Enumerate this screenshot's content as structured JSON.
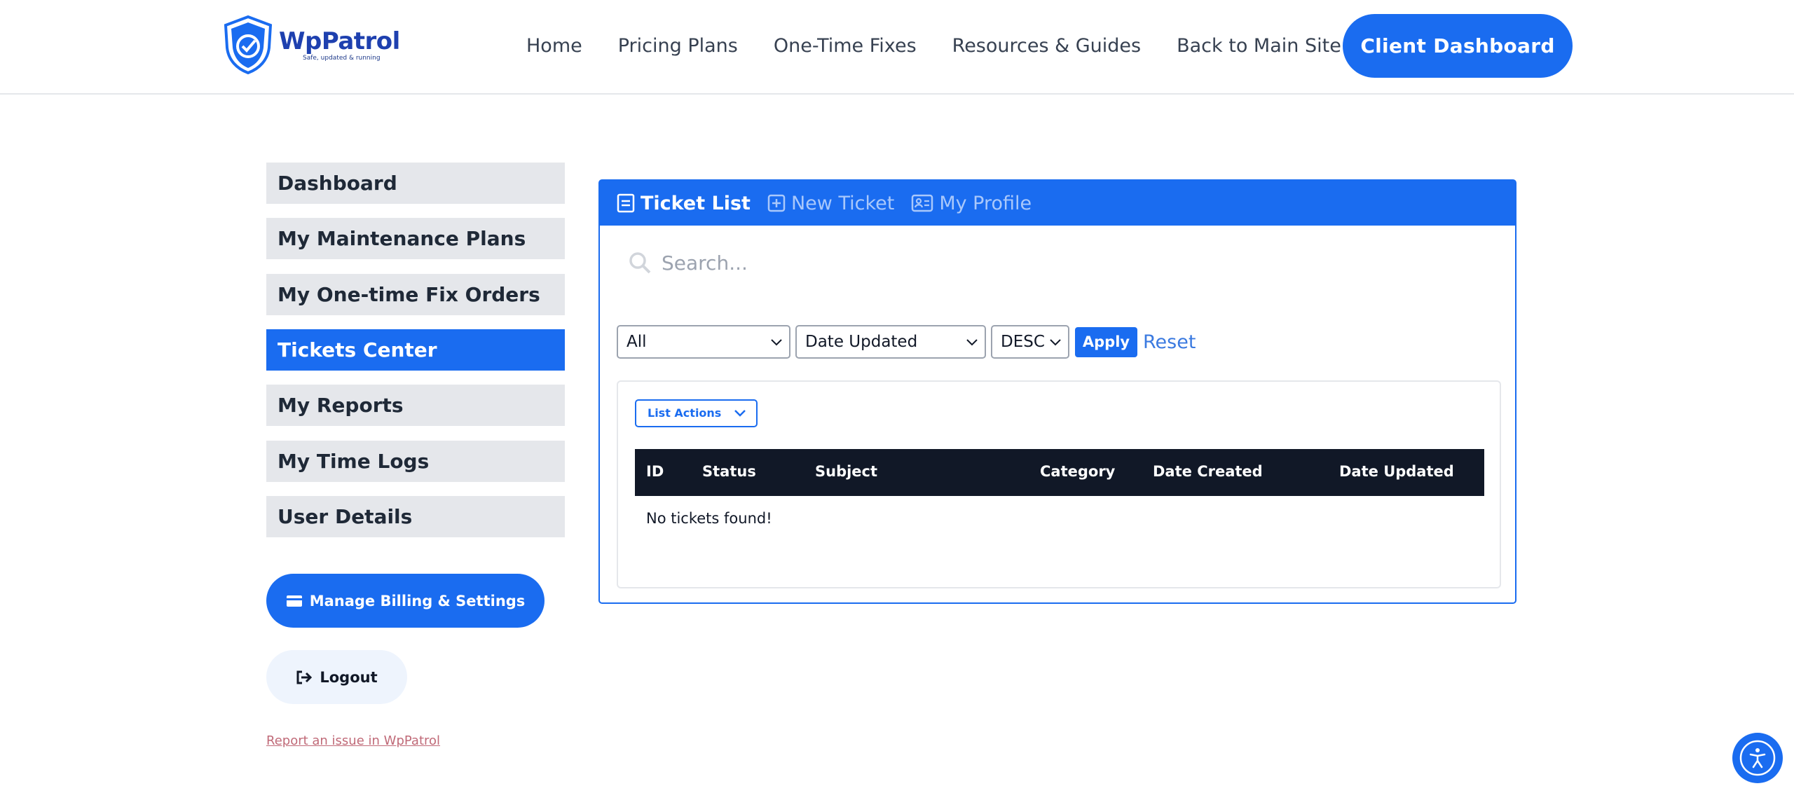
{
  "brand": {
    "name": "WpPatrol",
    "tagline": "Safe, updated & running"
  },
  "nav": {
    "items": [
      "Home",
      "Pricing Plans",
      "One-Time Fixes",
      "Resources & Guides",
      "Back to Main Site"
    ],
    "cta": "Client Dashboard"
  },
  "sidebar": {
    "items": [
      {
        "label": "Dashboard",
        "active": false
      },
      {
        "label": "My Maintenance Plans",
        "active": false
      },
      {
        "label": "My One-time Fix Orders",
        "active": false
      },
      {
        "label": "Tickets Center",
        "active": true
      },
      {
        "label": "My Reports",
        "active": false
      },
      {
        "label": "My Time Logs",
        "active": false
      },
      {
        "label": "User Details",
        "active": false
      }
    ],
    "billing_button": "Manage Billing & Settings",
    "logout_button": "Logout",
    "report_link": "Report an issue in WpPatrol"
  },
  "tickets": {
    "tabs": [
      {
        "label": "Ticket List",
        "icon": "list-icon",
        "active": true
      },
      {
        "label": "New Ticket",
        "icon": "plus-square-icon",
        "active": false
      },
      {
        "label": "My Profile",
        "icon": "profile-card-icon",
        "active": false
      }
    ],
    "search_placeholder": "Search...",
    "filters": {
      "status": "All",
      "sort_by": "Date Updated",
      "order": "DESC"
    },
    "apply_label": "Apply",
    "reset_label": "Reset",
    "list_actions_label": "List Actions",
    "columns": [
      "ID",
      "Status",
      "Subject",
      "Category",
      "Date Created",
      "Date Updated"
    ],
    "empty_message": "No tickets found!"
  },
  "colors": {
    "accent": "#1a6cf0",
    "table_header": "#111827",
    "sidebar_bg": "#e5e7eb"
  }
}
